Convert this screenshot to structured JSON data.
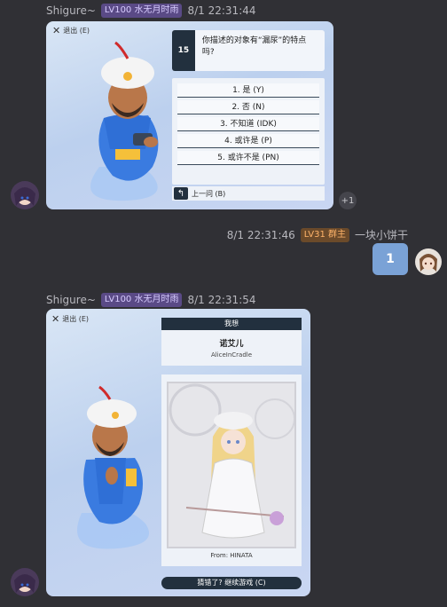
{
  "msg1": {
    "name": "Shigure~",
    "badge": "LV100 水无月时雨",
    "time": "8/1 22:31:44",
    "exit": "退出 (E)",
    "question_number": "15",
    "question": "你描述的对象有“漏尿”的特点吗?",
    "answers": [
      "1. 是 (Y)",
      "2. 否 (N)",
      "3. 不知道 (IDK)",
      "4. 或许是 (P)",
      "5. 或许不是 (PN)"
    ],
    "back": "上一问 (B)",
    "reaction": "+1"
  },
  "msg2": {
    "time": "8/1 22:31:46",
    "badge": "LV31 群主",
    "name": "一块小饼干",
    "text": "1"
  },
  "msg3": {
    "name": "Shigure~",
    "badge": "LV100 水无月时雨",
    "time": "8/1 22:31:54",
    "exit": "退出 (E)",
    "panel_title": "我想",
    "character_name": "诺艾儿",
    "character_source": "AliceInCradle",
    "from": "From: HINATA",
    "continue": "猜错了? 继续游戏 (C)"
  },
  "colors": {
    "badge_purple": "#5a4a86",
    "badge_orange": "#6b4a2a",
    "dark_navy": "#22303e",
    "bubble": "#7aa2d6",
    "background": "#303035"
  }
}
